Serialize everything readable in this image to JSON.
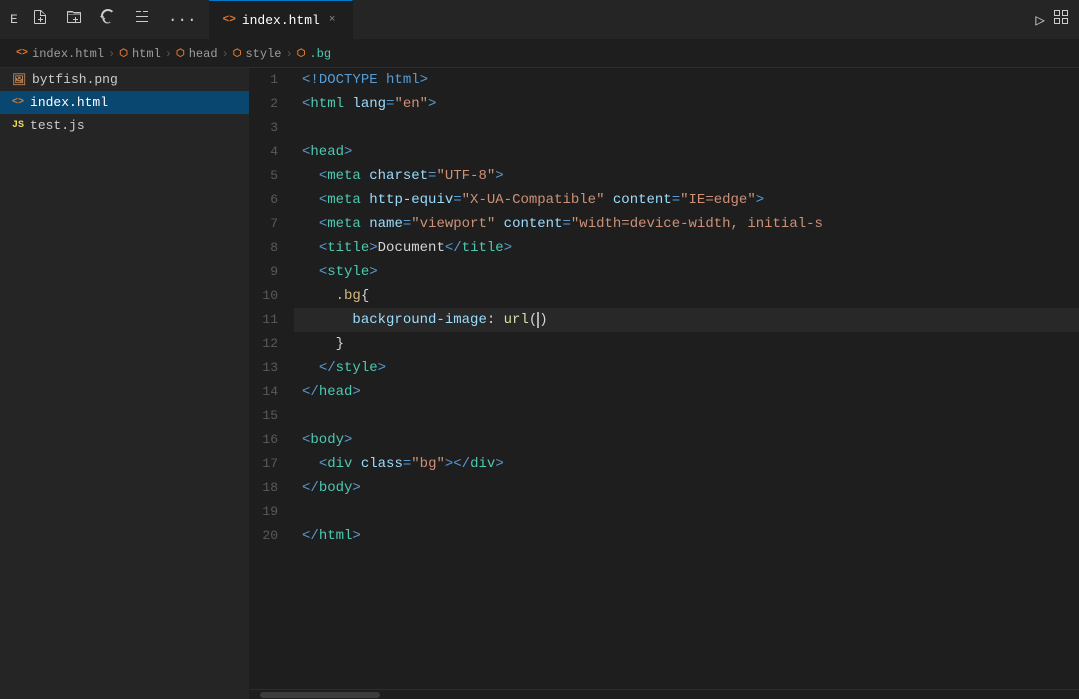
{
  "titlebar": {
    "explorer_icon": "E",
    "buttons": [
      "new-file",
      "new-folder",
      "refresh",
      "collapse"
    ],
    "more": "···",
    "run_icon": "▷",
    "layout_icon": "⊞"
  },
  "tab": {
    "icon": "<>",
    "label": "index.html",
    "close": "×"
  },
  "breadcrumb": {
    "items": [
      {
        "icon": "<>",
        "text": "index.html"
      },
      {
        "icon": "⬡",
        "text": "html"
      },
      {
        "icon": "⬡",
        "text": "head"
      },
      {
        "icon": "⬡",
        "text": "style"
      },
      {
        "icon": "⬡",
        "text": ".bg"
      }
    ]
  },
  "sidebar": {
    "files": [
      {
        "icon": "png",
        "name": "bytfish.png",
        "type": "png"
      },
      {
        "icon": "html",
        "name": "index.html",
        "type": "html",
        "active": true
      },
      {
        "icon": "js",
        "name": "test.js",
        "type": "js"
      }
    ]
  },
  "editor": {
    "lines": [
      {
        "num": 1,
        "content": "<!DOCTYPE html>",
        "type": "doctype"
      },
      {
        "num": 2,
        "content": "<html lang=\"en\">",
        "type": "html_open"
      },
      {
        "num": 3,
        "content": "",
        "type": "empty"
      },
      {
        "num": 4,
        "content": "<head>",
        "type": "tag_open"
      },
      {
        "num": 5,
        "content": "  <meta charset=\"UTF-8\">",
        "type": "meta1"
      },
      {
        "num": 6,
        "content": "  <meta http-equiv=\"X-UA-Compatible\" content=\"IE=edge\">",
        "type": "meta2"
      },
      {
        "num": 7,
        "content": "  <meta name=\"viewport\" content=\"width=device-width, initial-s",
        "type": "meta3"
      },
      {
        "num": 8,
        "content": "  <title>Document</title>",
        "type": "title"
      },
      {
        "num": 9,
        "content": "  <style>",
        "type": "style_open"
      },
      {
        "num": 10,
        "content": "    .bg{",
        "type": "selector"
      },
      {
        "num": 11,
        "content": "      background-image: url()",
        "type": "property",
        "active": true
      },
      {
        "num": 12,
        "content": "    }",
        "type": "close_brace"
      },
      {
        "num": 13,
        "content": "  </style>",
        "type": "style_close"
      },
      {
        "num": 14,
        "content": "</head>",
        "type": "head_close"
      },
      {
        "num": 15,
        "content": "",
        "type": "empty"
      },
      {
        "num": 16,
        "content": "<body>",
        "type": "body_open"
      },
      {
        "num": 17,
        "content": "  <div class=\"bg\"></div>",
        "type": "div"
      },
      {
        "num": 18,
        "content": "</body>",
        "type": "body_close"
      },
      {
        "num": 19,
        "content": "",
        "type": "empty"
      },
      {
        "num": 20,
        "content": "</html>",
        "type": "html_close"
      }
    ]
  }
}
